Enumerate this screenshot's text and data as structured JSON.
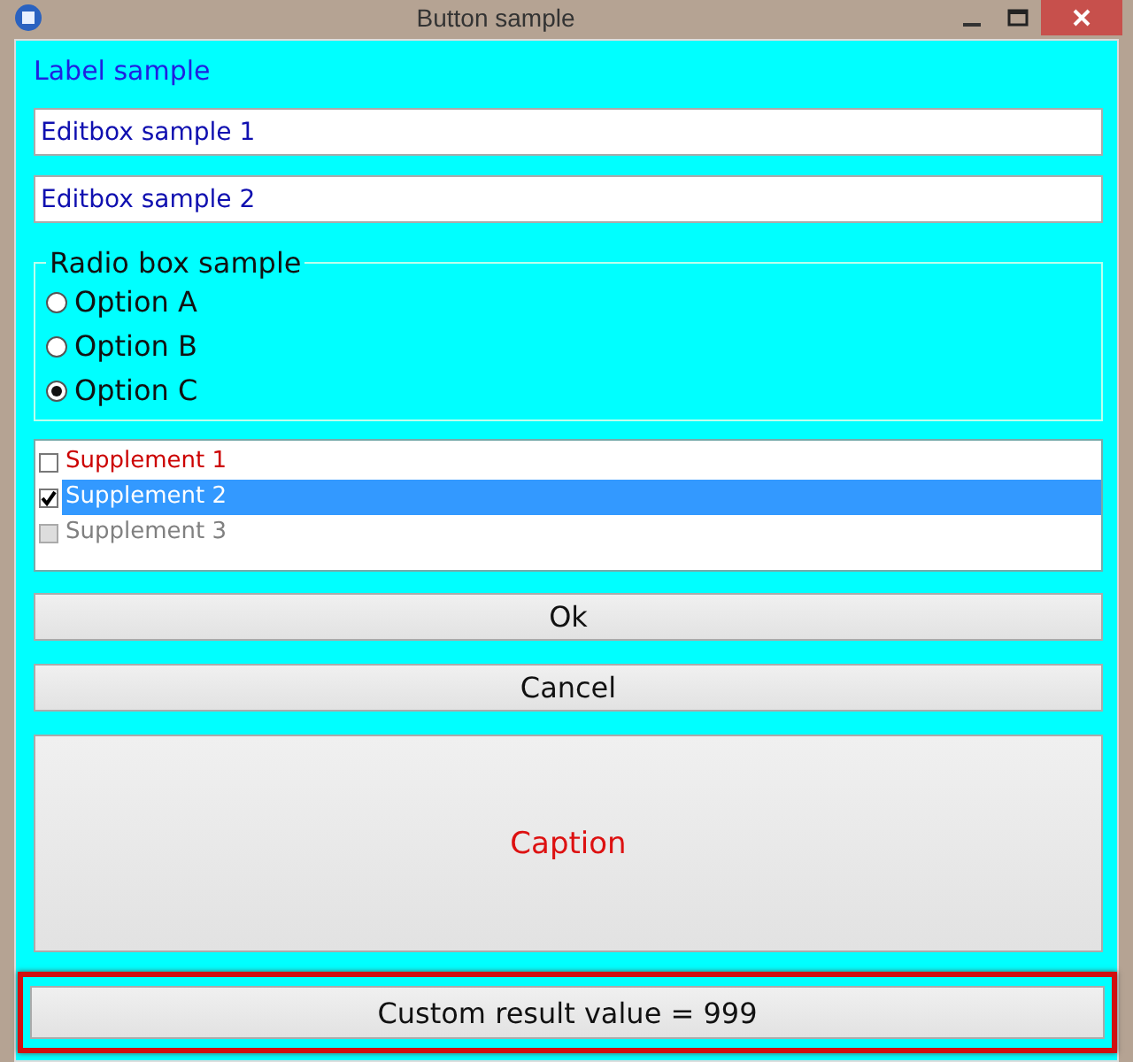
{
  "window": {
    "title": "Button sample"
  },
  "label": "Label sample",
  "editboxes": [
    {
      "value": "Editbox sample 1"
    },
    {
      "value": "Editbox sample 2"
    }
  ],
  "radio_group": {
    "title": "Radio box sample",
    "options": [
      {
        "label": "Option A",
        "selected": false
      },
      {
        "label": "Option B",
        "selected": false
      },
      {
        "label": "Option C",
        "selected": true
      }
    ]
  },
  "checklist": [
    {
      "label": "Supplement 1",
      "checked": false,
      "selected": false,
      "disabled": false,
      "color": "#cc0000"
    },
    {
      "label": "Supplement 2",
      "checked": true,
      "selected": true,
      "disabled": false
    },
    {
      "label": "Supplement 3",
      "checked": false,
      "selected": false,
      "disabled": true
    }
  ],
  "buttons": [
    {
      "label": "Ok",
      "kind": "normal",
      "focused": false
    },
    {
      "label": "Cancel",
      "kind": "normal",
      "focused": false
    },
    {
      "label": "Caption",
      "kind": "tall",
      "focused": false
    },
    {
      "label": "Custom result value = 999",
      "kind": "normal",
      "focused": true
    }
  ]
}
